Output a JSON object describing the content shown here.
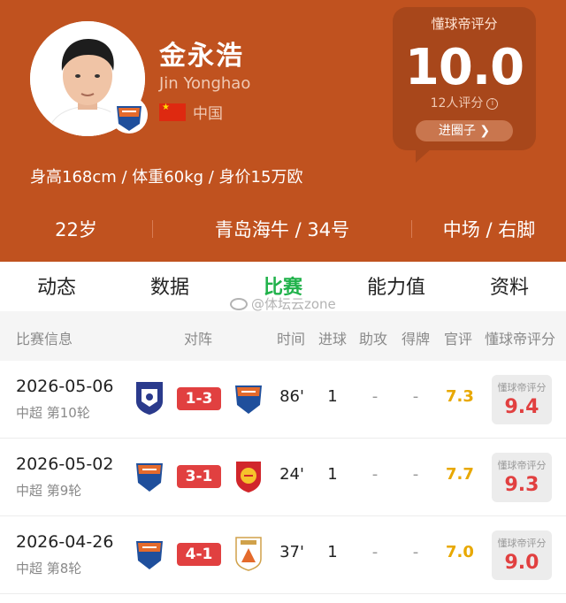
{
  "player": {
    "name_cn": "金永浩",
    "name_en": "Jin Yonghao",
    "nationality": "中国",
    "body_info": "身高168cm / 体重60kg / 身价15万欧",
    "age": "22岁",
    "club_number": "青岛海牛 / 34号",
    "position_foot": "中场 / 右脚"
  },
  "rating_card": {
    "title": "懂球帝评分",
    "value": "10.0",
    "count": "12人评分",
    "info_icon": "info-icon",
    "enter_button": "进圈子 ❯"
  },
  "tabs": [
    {
      "label": "动态",
      "active": false
    },
    {
      "label": "数据",
      "active": false
    },
    {
      "label": "比赛",
      "active": true
    },
    {
      "label": "能力值",
      "active": false
    },
    {
      "label": "资料",
      "active": false
    }
  ],
  "watermark": "@体坛云zone",
  "table_headers": {
    "match_info": "比赛信息",
    "matchup": "对阵",
    "time": "时间",
    "goals": "进球",
    "assists": "助攻",
    "cards": "得牌",
    "official": "官评",
    "dqd": "懂球帝评分"
  },
  "matches": [
    {
      "date": "2026-05-06",
      "round": "中超  第10轮",
      "home_logo": "shield-crest-icon",
      "score": "1-3",
      "away_logo": "qingdao-hainiu-crest-icon",
      "minutes": "86'",
      "goals": "1",
      "assists": "-",
      "cards": "-",
      "official": "7.3",
      "dqd_label": "懂球帝评分",
      "dqd": "9.4"
    },
    {
      "date": "2026-05-02",
      "round": "中超  第9轮",
      "home_logo": "qingdao-hainiu-crest-icon",
      "score": "3-1",
      "away_logo": "shanghai-port-crest-icon",
      "minutes": "24'",
      "goals": "1",
      "assists": "-",
      "cards": "-",
      "official": "7.7",
      "dqd_label": "懂球帝评分",
      "dqd": "9.3"
    },
    {
      "date": "2026-04-26",
      "round": "中超  第8轮",
      "home_logo": "qingdao-hainiu-crest-icon",
      "score": "4-1",
      "away_logo": "taishan-crest-icon",
      "minutes": "37'",
      "goals": "1",
      "assists": "-",
      "cards": "-",
      "official": "7.0",
      "dqd_label": "懂球帝评分",
      "dqd": "9.0"
    }
  ],
  "colors": {
    "header_bg": "#c0521f",
    "active_tab": "#21b24b",
    "score_bg": "#e14040",
    "official_rating": "#e8a800"
  }
}
